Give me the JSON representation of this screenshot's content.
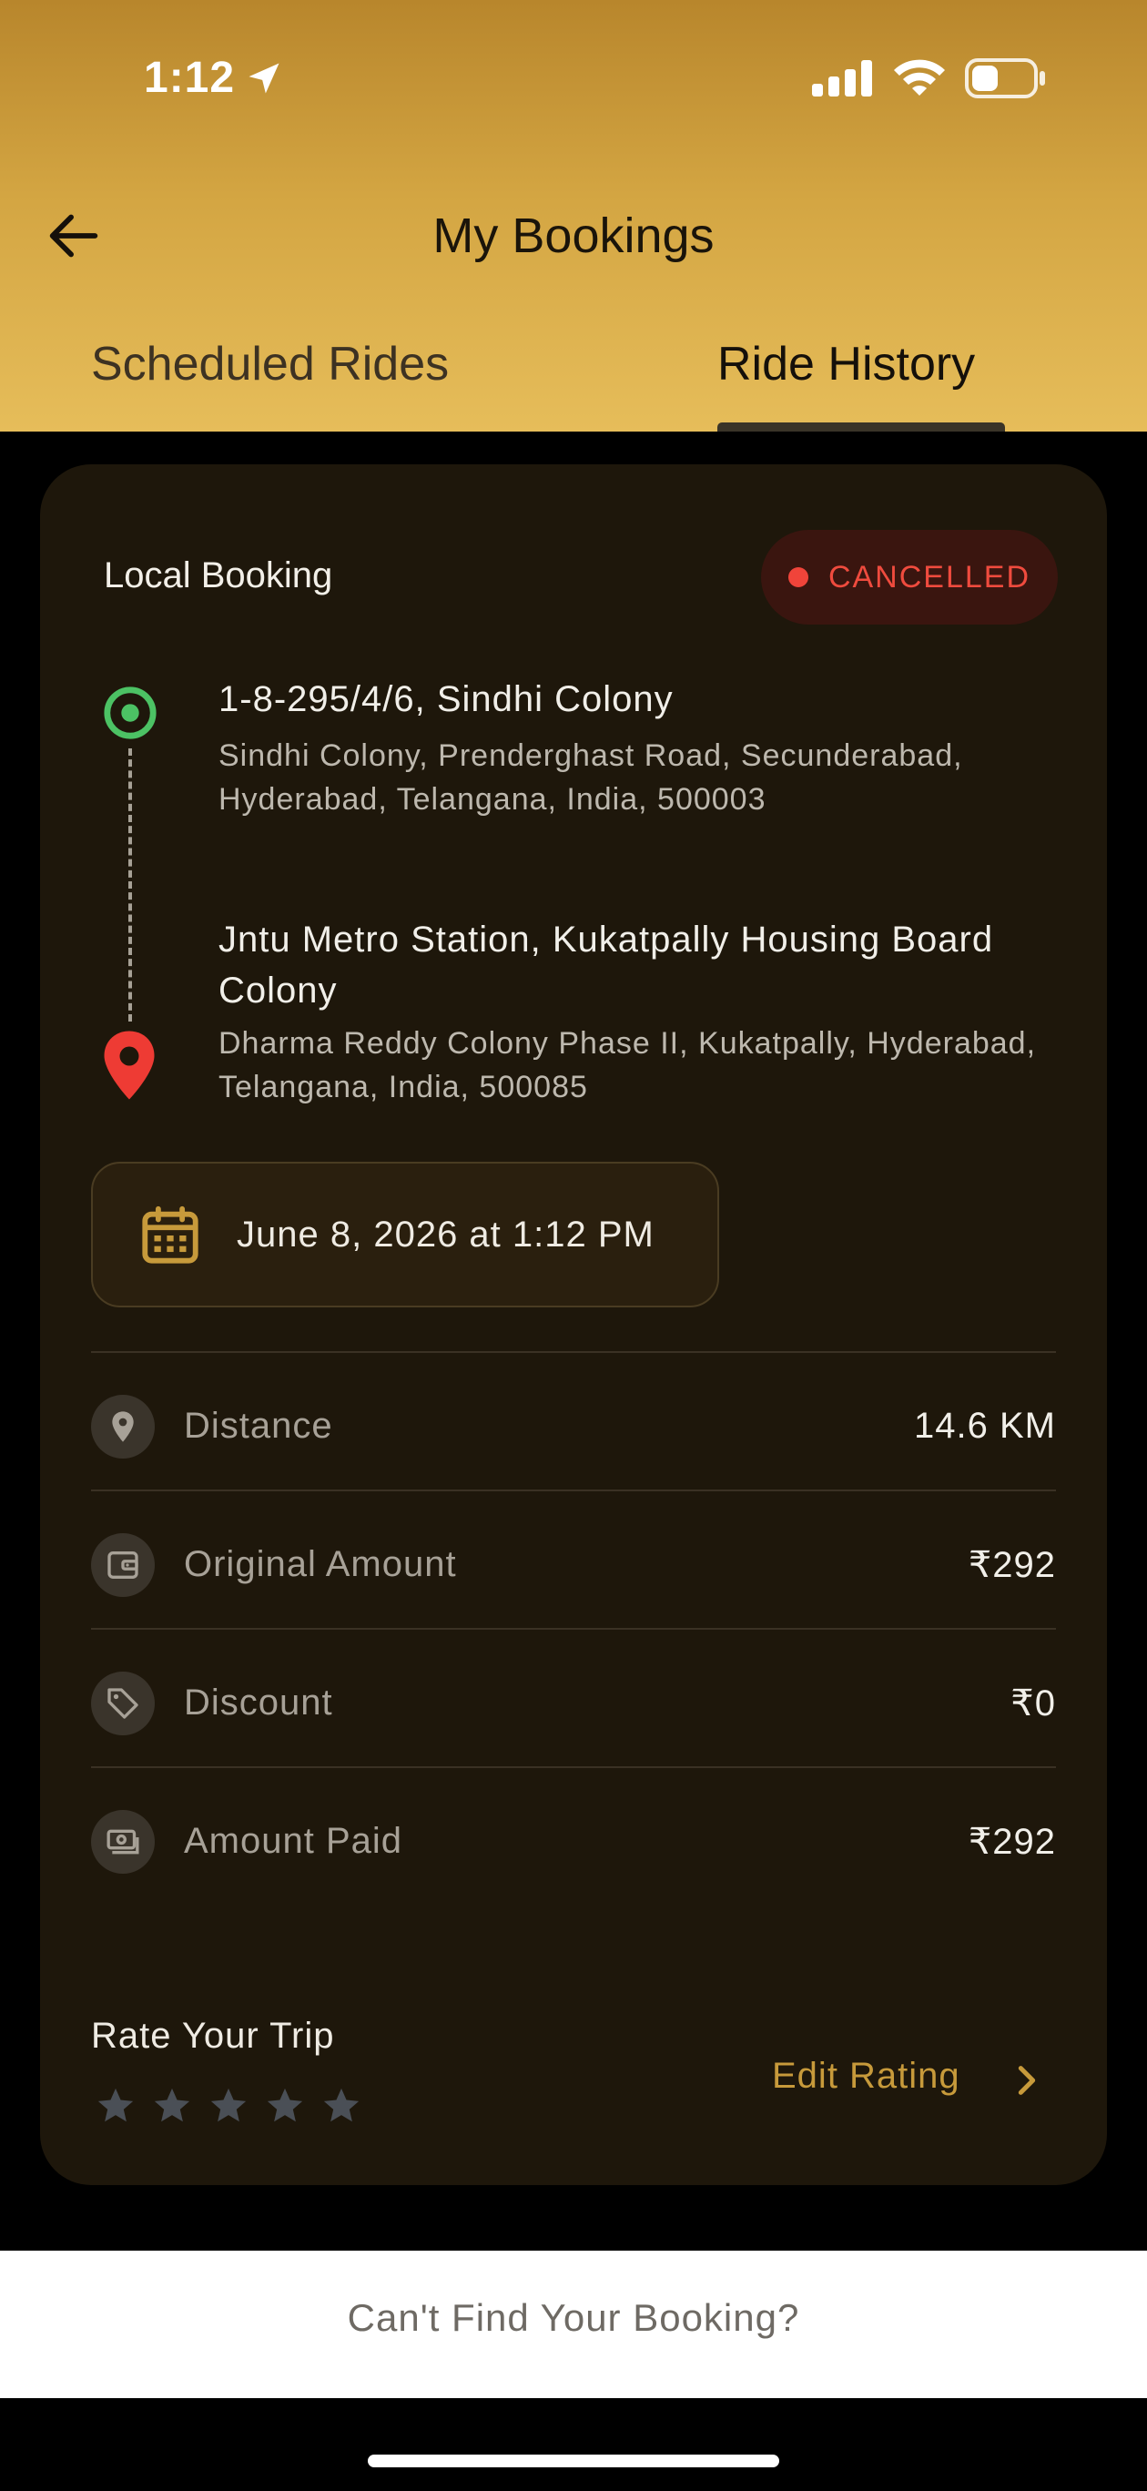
{
  "status_bar": {
    "time": "1:12"
  },
  "nav": {
    "title": "My Bookings"
  },
  "tabs": [
    {
      "label": "Scheduled Rides",
      "active": false
    },
    {
      "label": "Ride History",
      "active": true
    }
  ],
  "booking": {
    "type": "Local Booking",
    "status": "CANCELLED",
    "pickup": {
      "name": "1-8-295/4/6, Sindhi Colony",
      "address": "Sindhi Colony, Prenderghast Road, Secunderabad, Hyderabad, Telangana, India, 500003"
    },
    "drop": {
      "name": "Jntu Metro Station, Kukatpally Housing Board Colony",
      "address": "Dharma Reddy Colony Phase II,  Kukatpally,  Hyderabad,  Telangana,  India,  500085"
    },
    "datetime": "June 8, 2026 at 1:12 PM",
    "details": [
      {
        "label": "Distance",
        "value": "14.6 KM",
        "icon": "location-pin-icon"
      },
      {
        "label": "Original Amount",
        "value": "₹292",
        "icon": "wallet-icon"
      },
      {
        "label": "Discount",
        "value": "₹0",
        "icon": "tag-icon"
      },
      {
        "label": "Amount Paid",
        "value": "₹292",
        "icon": "cash-icon"
      }
    ],
    "rating": {
      "label": "Rate Your Trip",
      "stars": 0,
      "max_stars": 5,
      "edit_label": "Edit Rating"
    }
  },
  "footer": {
    "cant_find": "Can't Find Your Booking?"
  },
  "colors": {
    "accent": "#c79a3b",
    "cancelled": "#ef4b3e",
    "pickup": "#4cc264",
    "drop": "#ee3b34",
    "card": "#1e170b"
  }
}
